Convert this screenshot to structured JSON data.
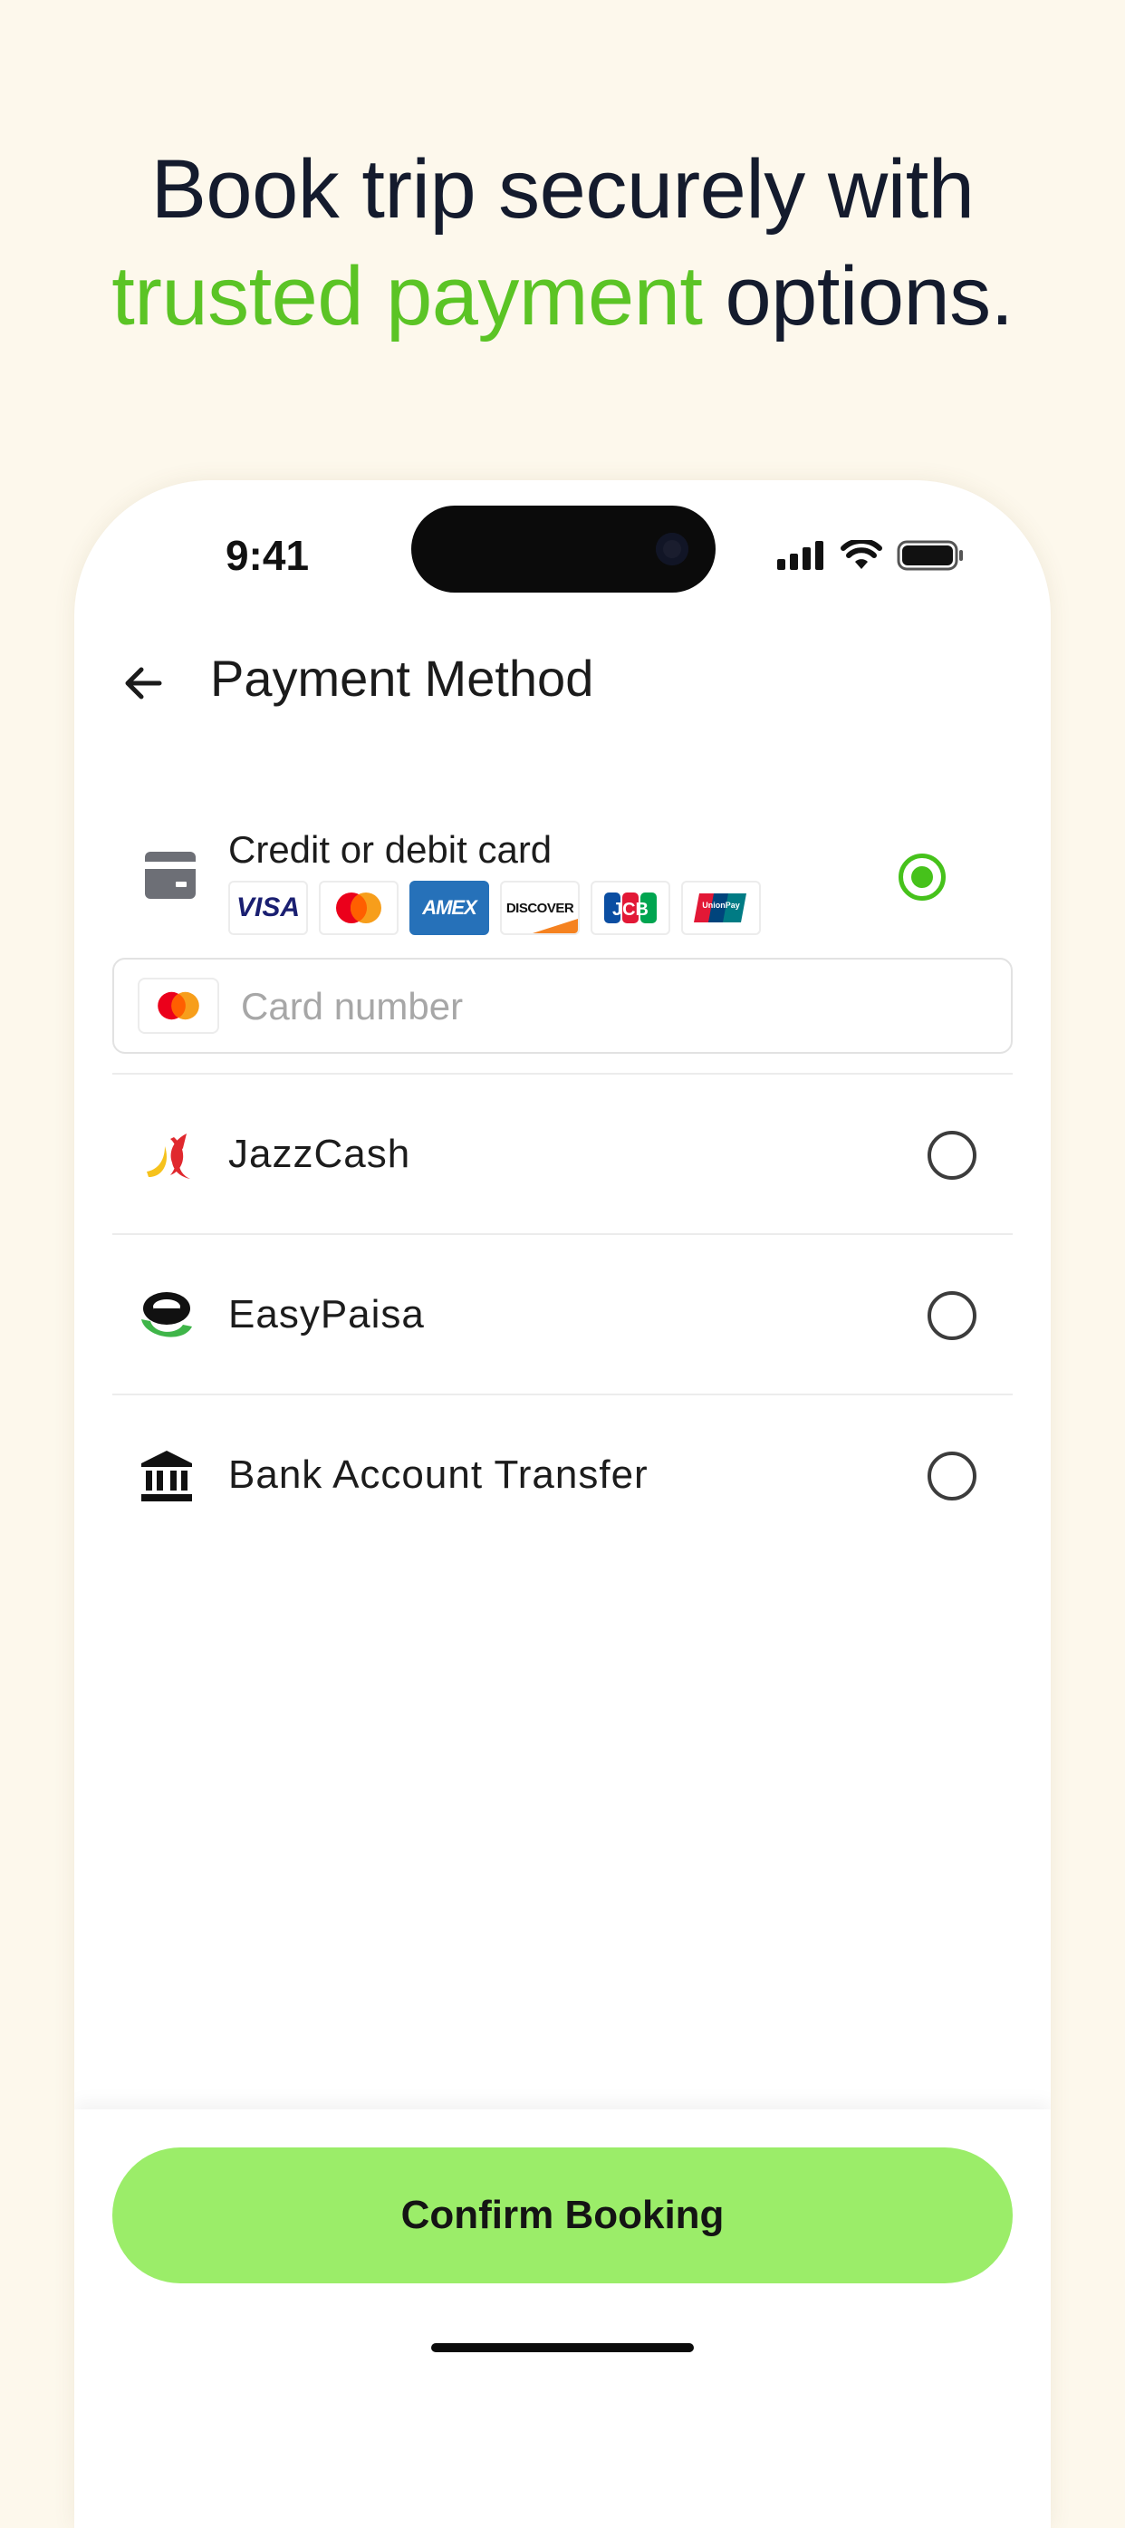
{
  "headline": {
    "line1": "Book trip securely with",
    "accent": "trusted payment",
    "rest": " options."
  },
  "status_bar": {
    "time": "9:41"
  },
  "header": {
    "title": "Payment Method"
  },
  "card_option": {
    "label": "Credit or debit card",
    "selected": true,
    "brands": [
      {
        "name": "VISA",
        "icon": "visa-logo"
      },
      {
        "name": "Mastercard",
        "icon": "mastercard-logo"
      },
      {
        "name": "AMEX",
        "icon": "amex-logo"
      },
      {
        "name": "DISCOVER",
        "icon": "discover-logo"
      },
      {
        "name": "JCB",
        "icon": "jcb-logo"
      },
      {
        "name": "UnionPay",
        "icon": "unionpay-logo"
      }
    ],
    "input": {
      "placeholder": "Card number",
      "value": ""
    }
  },
  "payment_options": [
    {
      "label": "JazzCash",
      "icon": "jazzcash-logo",
      "selected": false
    },
    {
      "label": "EasyPaisa",
      "icon": "easypaisa-logo",
      "selected": false
    },
    {
      "label": "Bank Account Transfer",
      "icon": "bank-icon",
      "selected": false
    }
  ],
  "footer": {
    "confirm_label": "Confirm Booking"
  },
  "colors": {
    "accent_green": "#5bc425",
    "radio_green": "#46c21b",
    "button_green": "#9bed69",
    "page_bg": "#fdf8ec"
  }
}
